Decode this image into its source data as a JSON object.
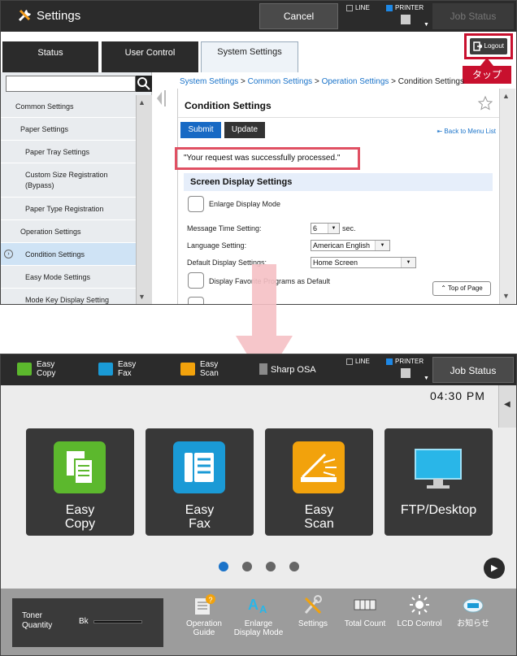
{
  "top": {
    "app_title": "Settings",
    "cancel": "Cancel",
    "line_label": "LINE",
    "printer_label": "PRINTER",
    "job_status": "Job Status",
    "tabs": [
      {
        "label": "Status"
      },
      {
        "label": "User Control"
      },
      {
        "label": "System Settings"
      }
    ],
    "logout": "Logout",
    "tap_label": "タップ",
    "search_placeholder": "",
    "sidebar": [
      "Common Settings",
      "Paper Settings",
      "Paper Tray Settings",
      "Custom Size Registration (Bypass)",
      "Paper Type Registration",
      "Operation Settings",
      "Condition Settings",
      "Easy Mode Settings",
      "Mode Key Display Setting"
    ],
    "breadcrumb": {
      "a": "System Settings",
      "b": "Common Settings",
      "c": "Operation Settings",
      "d": "Condition Settings",
      "sep": ">"
    },
    "page_title": "Condition Settings",
    "submit": "Submit",
    "update": "Update",
    "back_link": "Back to Menu List",
    "success_message": "\"Your request was successfully processed.\"",
    "section": "Screen Display Settings",
    "enlarge": "Enlarge Display Mode",
    "msg_time_label": "Message Time Setting:",
    "msg_time_value": "6",
    "msg_time_unit": "sec.",
    "language_label": "Language Setting:",
    "language_value": "American English",
    "default_display_label": "Default Display Settings:",
    "default_display_value": "Home Screen",
    "display_fav_label": "Display Favorite Programs as Default",
    "top_of_page": "Top of Page"
  },
  "bottom": {
    "quick": [
      {
        "label": "Easy Copy",
        "color": "#5cb82d"
      },
      {
        "label": "Easy Fax",
        "color": "#1a9ad6"
      },
      {
        "label": "Easy Scan",
        "color": "#f2a20c"
      }
    ],
    "osa": "Sharp OSA",
    "line_label": "LINE",
    "printer_label": "PRINTER",
    "job_status": "Job Status",
    "clock": "04:30 PM",
    "tiles": [
      {
        "label1": "Easy",
        "label2": "Copy",
        "icon": "copy-icon",
        "color": "#5cb82d"
      },
      {
        "label1": "Easy",
        "label2": "Fax",
        "icon": "fax-icon",
        "color": "#1a9ad6"
      },
      {
        "label1": "Easy",
        "label2": "Scan",
        "icon": "scan-icon",
        "color": "#f2a20c"
      },
      {
        "label1": "FTP/Desktop",
        "label2": "",
        "icon": "monitor-icon",
        "color": "#29b6e8"
      }
    ],
    "page_dots": 4,
    "active_dot": 1,
    "toner_label": "Toner Quantity",
    "toner_color": "Bk",
    "shortcuts": [
      {
        "label": "Operation Guide",
        "icon": "operation-guide-icon"
      },
      {
        "label": "Enlarge Display Mode",
        "icon": "enlarge-display-icon"
      },
      {
        "label": "Settings",
        "icon": "settings-icon"
      },
      {
        "label": "Total Count",
        "icon": "total-count-icon"
      },
      {
        "label": "LCD Control",
        "icon": "lcd-control-icon"
      },
      {
        "label": "お知らせ",
        "icon": "notice-icon"
      }
    ]
  }
}
